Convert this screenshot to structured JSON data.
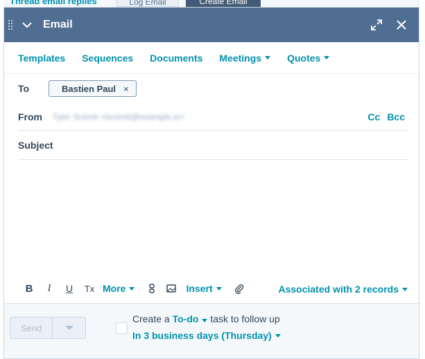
{
  "background": {
    "tabs": [
      "Thread email replies",
      "Log Email",
      "Create Email"
    ]
  },
  "header": {
    "title": "Email",
    "collapse_icon": "chevron-down-icon",
    "expand_icon": "expand-icon",
    "close_icon": "close-icon"
  },
  "toolbar": {
    "items": [
      "Templates",
      "Sequences",
      "Documents",
      "Meetings",
      "Quotes"
    ]
  },
  "to": {
    "label": "To",
    "recipient": "Bastien Paul",
    "remove_glyph": "×"
  },
  "from": {
    "label": "From",
    "value": "Tyler Scionti <tscionti@example.io>",
    "cc": "Cc",
    "bcc": "Bcc"
  },
  "subject": {
    "label": "Subject",
    "value": ""
  },
  "format_bar": {
    "bold": "B",
    "italic": "I",
    "underline": "U",
    "clear_format": "Tx",
    "more": "More",
    "insert": "Insert",
    "associated": "Associated with 2 records"
  },
  "footer": {
    "send": "Send",
    "todo_prefix": "Create a",
    "todo_type": "To-do",
    "todo_suffix": "task to follow up",
    "due": "In 3 business days (Thursday)"
  },
  "colors": {
    "header_bg": "#506e91",
    "link": "#0091ae",
    "text": "#33475b"
  }
}
